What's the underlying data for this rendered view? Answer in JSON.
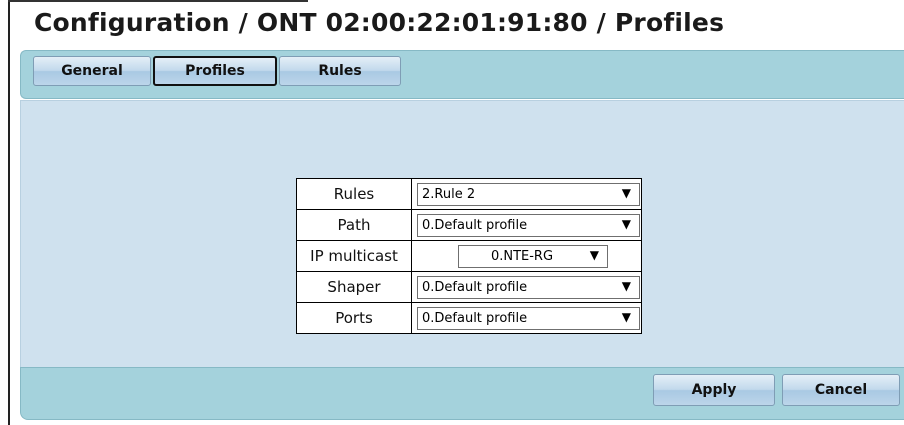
{
  "title": "Configuration / ONT 02:00:22:01:91:80 / Profiles",
  "tabs": [
    {
      "label": "General",
      "active": false
    },
    {
      "label": "Profiles",
      "active": true
    },
    {
      "label": "Rules",
      "active": false
    }
  ],
  "form": {
    "rows": [
      {
        "label": "Rules",
        "value": "2.Rule 2"
      },
      {
        "label": "Path",
        "value": "0.Default profile"
      },
      {
        "label": "IP multicast",
        "value": "0.NTE-RG"
      },
      {
        "label": "Shaper",
        "value": "0.Default profile"
      },
      {
        "label": "Ports",
        "value": "0.Default profile"
      }
    ]
  },
  "buttons": {
    "apply_label": "Apply",
    "cancel_label": "Cancel"
  },
  "icons": {
    "dropdown_arrow": "▼"
  }
}
